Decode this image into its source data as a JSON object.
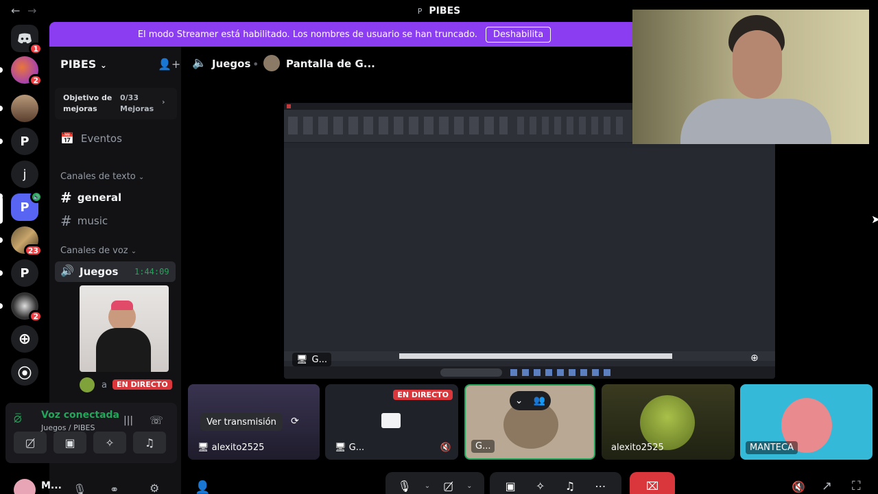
{
  "window": {
    "title": "PIBES",
    "title_prefix": "P"
  },
  "banner": {
    "text": "El modo Streamer está habilitado. Los nombres de usuario se han truncado.",
    "button": "Deshabilita"
  },
  "servers": [
    {
      "letter": "",
      "badge": "1"
    },
    {
      "letter": "",
      "badge": "2"
    },
    {
      "letter": "",
      "badge": ""
    },
    {
      "letter": "P",
      "badge": ""
    },
    {
      "letter": "j",
      "badge": ""
    },
    {
      "letter": "P",
      "badge": ""
    },
    {
      "letter": "",
      "badge": "23"
    },
    {
      "letter": "P",
      "badge": ""
    },
    {
      "letter": "",
      "badge": "2"
    }
  ],
  "sidebar": {
    "server_name": "PIBES",
    "boost": {
      "label_line1": "Objetivo de",
      "label_line2": "mejoras",
      "count": "0/33",
      "unit": "Mejoras"
    },
    "events": "Eventos",
    "text_category": "Canales de texto",
    "text_channels": [
      "general",
      "music"
    ],
    "voice_category": "Canales de voz",
    "voice_channel": {
      "name": "Juegos",
      "timer": "1:44:09"
    },
    "member_live": {
      "name": "a",
      "badge": "EN DIRECTO"
    }
  },
  "voice_panel": {
    "status": "Voz conectada",
    "location": "Juegos / PIBES"
  },
  "user": {
    "name": "M..."
  },
  "header": {
    "channel": "Juegos",
    "stream": "Pantalla de G..."
  },
  "stream": {
    "label": "G..."
  },
  "tiles": [
    {
      "label": "alexito2525",
      "button": "Ver transmisión"
    },
    {
      "label": "G...",
      "live": "EN DIRECTO"
    },
    {
      "label": "G..."
    },
    {
      "label": "alexito2525"
    },
    {
      "label": "MANTECA"
    }
  ],
  "colors": {
    "accent": "#8b3df1",
    "live": "#da373c",
    "connected": "#23a55a",
    "leave": "#da373c"
  }
}
